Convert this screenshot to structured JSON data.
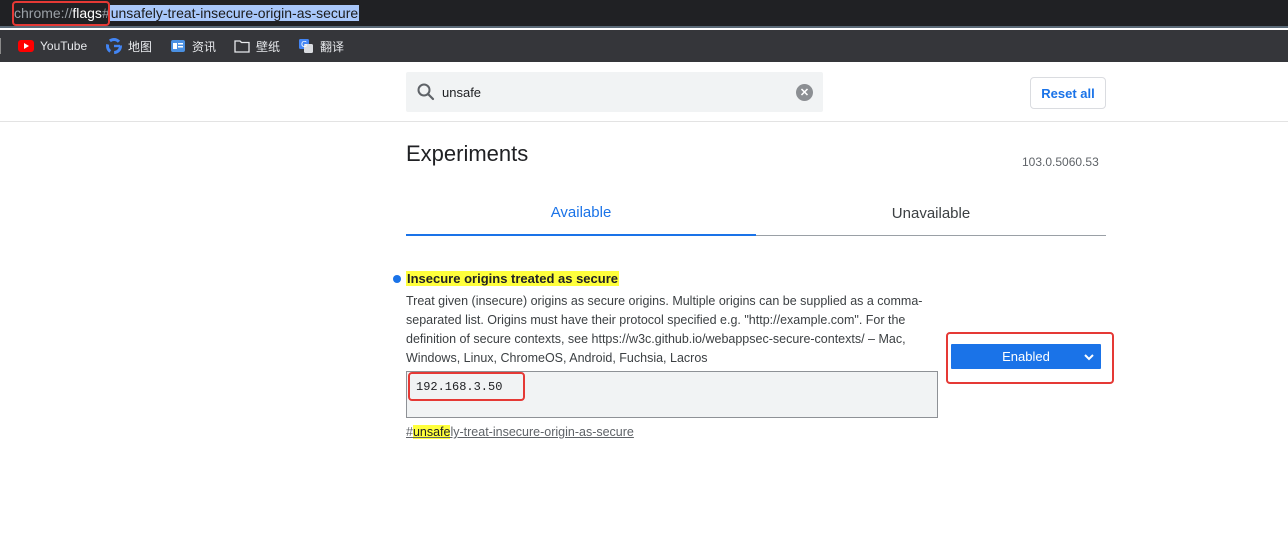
{
  "url": {
    "scheme": "chrome://",
    "host": "flags",
    "hash": "#",
    "fragment": "unsafely-treat-insecure-origin-as-secure"
  },
  "bookmarks": [
    {
      "label": "YouTube",
      "icon": "youtube-icon"
    },
    {
      "label": "地图",
      "icon": "google-icon"
    },
    {
      "label": "资讯",
      "icon": "news-icon"
    },
    {
      "label": "壁纸",
      "icon": "folder-icon"
    },
    {
      "label": "翻译",
      "icon": "translate-icon"
    }
  ],
  "search": {
    "value": "unsafe",
    "reset_label": "Reset all"
  },
  "page": {
    "title": "Experiments",
    "version": "103.0.5060.53"
  },
  "tabs": [
    {
      "label": "Available",
      "active": true
    },
    {
      "label": "Unavailable",
      "active": false
    }
  ],
  "experiment": {
    "title": "Insecure origins treated as secure",
    "description": "Treat given (insecure) origins as secure origins. Multiple origins can be supplied as a comma-separated list. Origins must have their protocol specified e.g. \"http://example.com\". For the definition of secure contexts, see https://w3c.github.io/webappsec-secure-contexts/ – Mac, Windows, Linux, ChromeOS, Android, Fuchsia, Lacros",
    "origins_value": "192.168.3.50",
    "link_hash": "#",
    "link_highlight": "unsafe",
    "link_rest": "ly-treat-insecure-origin-as-secure",
    "state": "Enabled"
  },
  "colors": {
    "accent": "#1a73e8",
    "highlight": "#ffff3c",
    "annotation": "#e53935"
  }
}
